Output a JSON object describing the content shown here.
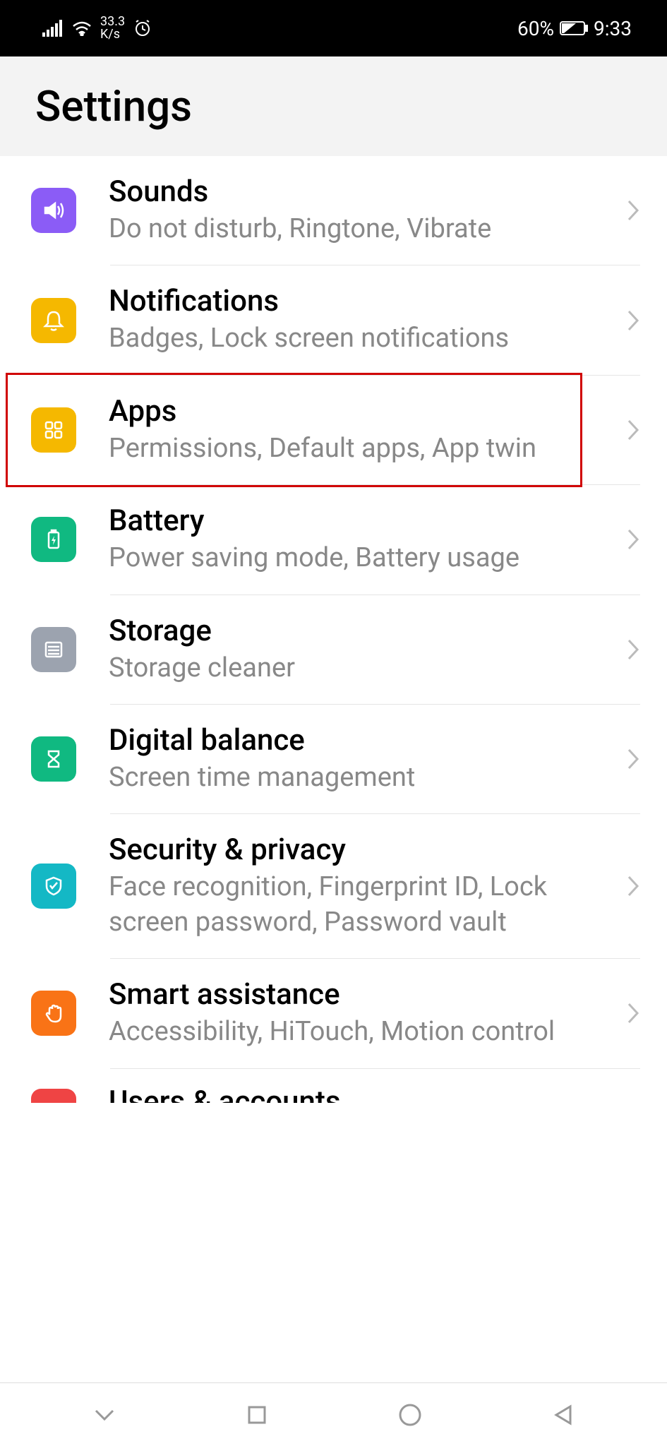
{
  "status": {
    "speed_value": "33.3",
    "speed_unit": "K/s",
    "battery_percent": "60%",
    "time": "9:33"
  },
  "header": {
    "title": "Settings"
  },
  "items": [
    {
      "title": "Sounds",
      "subtitle": "Do not disturb, Ringtone, Vibrate",
      "icon": "sound",
      "color": "purple"
    },
    {
      "title": "Notifications",
      "subtitle": "Badges, Lock screen notifications",
      "icon": "bell",
      "color": "yellow"
    },
    {
      "title": "Apps",
      "subtitle": "Permissions, Default apps, App twin",
      "icon": "apps",
      "color": "yellow",
      "highlighted": true
    },
    {
      "title": "Battery",
      "subtitle": "Power saving mode, Battery usage",
      "icon": "battery",
      "color": "green"
    },
    {
      "title": "Storage",
      "subtitle": "Storage cleaner",
      "icon": "storage",
      "color": "gray"
    },
    {
      "title": "Digital balance",
      "subtitle": "Screen time management",
      "icon": "hourglass",
      "color": "green"
    },
    {
      "title": "Security & privacy",
      "subtitle": "Face recognition, Fingerprint ID, Lock screen password, Password vault",
      "icon": "shield",
      "color": "teal"
    },
    {
      "title": "Smart assistance",
      "subtitle": "Accessibility, HiTouch, Motion control",
      "icon": "hand",
      "color": "orange"
    }
  ],
  "partial_item": {
    "title": "Users & accounts",
    "color": "red"
  }
}
